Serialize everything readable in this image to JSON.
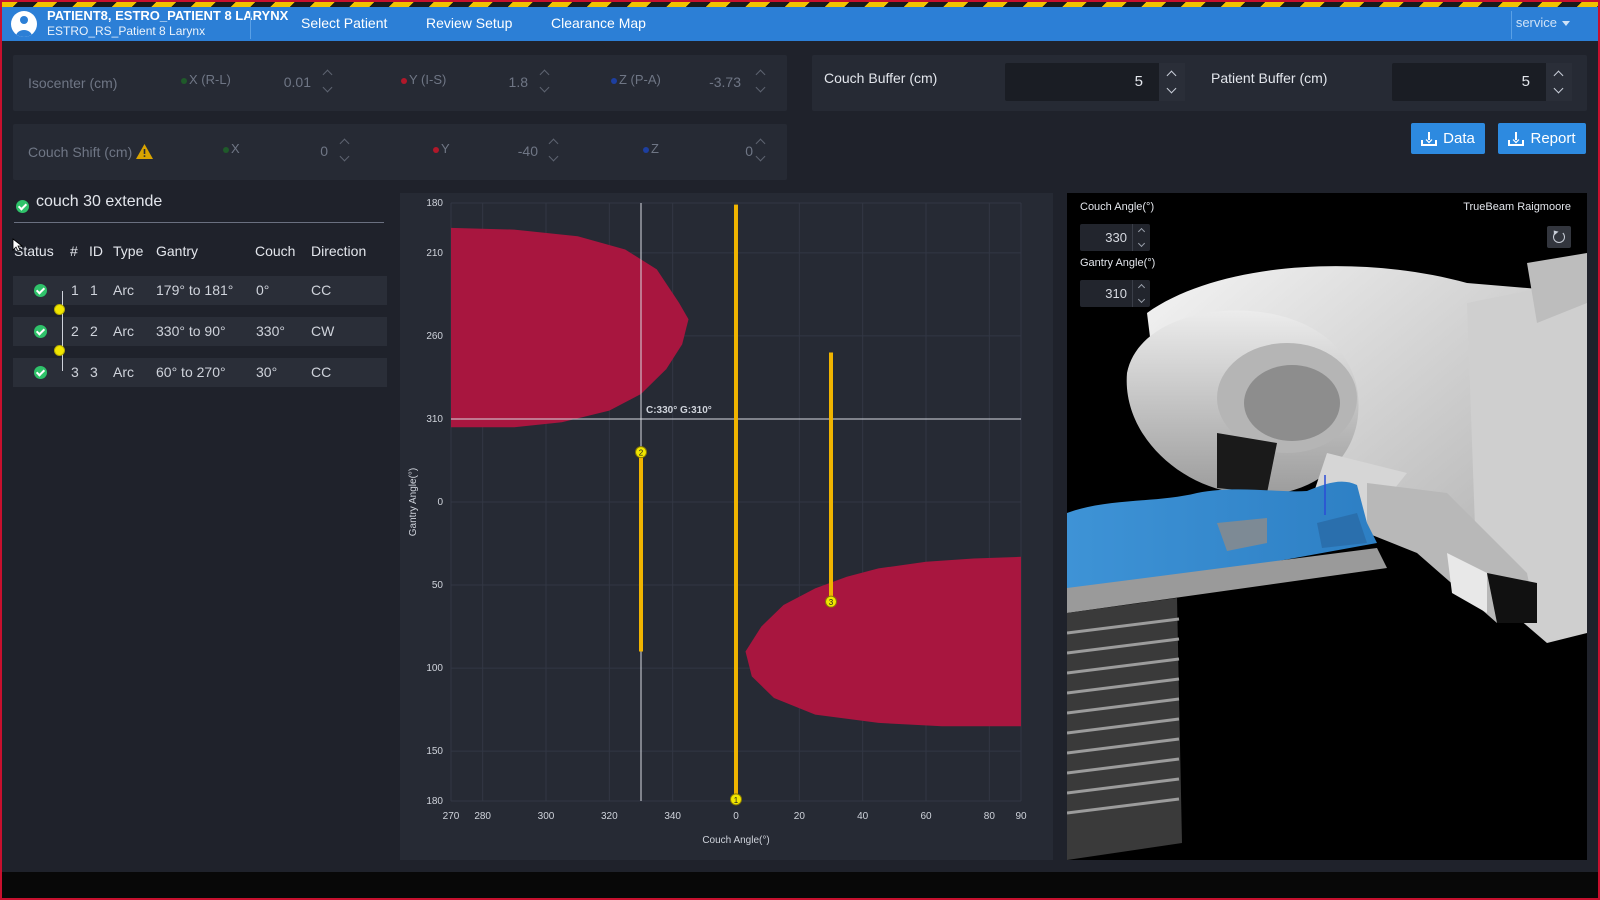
{
  "header": {
    "patient_name": "PATIENT8, ESTRO_PATIENT 8 LARYNX",
    "plan_name": "ESTRO_RS_Patient 8 Larynx",
    "nav": [
      {
        "label": "Select Patient"
      },
      {
        "label": "Review Setup"
      },
      {
        "label": "Clearance Map"
      }
    ],
    "active_nav": "Clearance Map",
    "user_menu": "service"
  },
  "isocenter": {
    "label": "Isocenter (cm)",
    "x": {
      "label": "X (R-L)",
      "value": "0.01"
    },
    "y": {
      "label": "Y (I-S)",
      "value": "1.8"
    },
    "z": {
      "label": "Z (P-A)",
      "value": "-3.73"
    }
  },
  "couch_shift": {
    "label": "Couch Shift (cm)",
    "x": {
      "label": "X",
      "value": "0"
    },
    "y": {
      "label": "Y",
      "value": "-40"
    },
    "z": {
      "label": "Z",
      "value": "0"
    }
  },
  "buffers": {
    "couch": {
      "label": "Couch Buffer (cm)",
      "value": "5"
    },
    "patient": {
      "label": "Patient Buffer (cm)",
      "value": "5"
    }
  },
  "buttons": {
    "data": "Data",
    "report": "Report"
  },
  "plan": {
    "title": "couch 30 extende",
    "columns": [
      "Status",
      "#",
      "ID",
      "Type",
      "Gantry",
      "Couch",
      "Direction"
    ],
    "rows": [
      {
        "num": "1",
        "id": "1",
        "type": "Arc",
        "gantry": "179° to 181°",
        "couch": "0°",
        "direction": "CC"
      },
      {
        "num": "2",
        "id": "2",
        "type": "Arc",
        "gantry": "330° to 90°",
        "couch": "330°",
        "direction": "CW"
      },
      {
        "num": "3",
        "id": "3",
        "type": "Arc",
        "gantry": "60° to 270°",
        "couch": "30°",
        "direction": "CC"
      }
    ]
  },
  "colors": {
    "collision": "#a8163f",
    "arc": "#f0b400",
    "accent": "#2d8ae0",
    "ok": "#2fc26a"
  },
  "chart_data": {
    "type": "scatter",
    "xlabel": "Couch Angle(°)",
    "ylabel": "Gantry Angle(°)",
    "x_ticks": [
      "270",
      "280",
      "300",
      "320",
      "340",
      "0",
      "20",
      "40",
      "60",
      "80",
      "90"
    ],
    "x_tick_values": [
      -90,
      -80,
      -60,
      -40,
      -20,
      0,
      20,
      40,
      60,
      80,
      90
    ],
    "y_ticks": [
      "180",
      "210",
      "260",
      "310",
      "0",
      "50",
      "100",
      "150",
      "180"
    ],
    "y_tick_values": [
      -180,
      -150,
      -100,
      -50,
      0,
      50,
      100,
      150,
      180
    ],
    "xlim": [
      -90,
      90
    ],
    "ylim": [
      -180,
      180
    ],
    "cursor": {
      "couch": -30,
      "gantry": -50,
      "label": "C:330° G:310°"
    },
    "collision_regions": [
      {
        "name": "upper-left",
        "outline": [
          [
            -90,
            -165
          ],
          [
            -70,
            -164
          ],
          [
            -50,
            -160
          ],
          [
            -35,
            -152
          ],
          [
            -25,
            -140
          ],
          [
            -18,
            -120
          ],
          [
            -15,
            -110
          ],
          [
            -17,
            -95
          ],
          [
            -22,
            -80
          ],
          [
            -30,
            -65
          ],
          [
            -40,
            -55
          ],
          [
            -55,
            -48
          ],
          [
            -70,
            -45
          ],
          [
            -90,
            -45
          ]
        ]
      },
      {
        "name": "lower-right",
        "outline": [
          [
            90,
            33
          ],
          [
            75,
            34
          ],
          [
            60,
            36
          ],
          [
            45,
            40
          ],
          [
            35,
            45
          ],
          [
            25,
            52
          ],
          [
            15,
            62
          ],
          [
            8,
            75
          ],
          [
            3,
            90
          ],
          [
            5,
            105
          ],
          [
            12,
            118
          ],
          [
            25,
            128
          ],
          [
            45,
            133
          ],
          [
            65,
            135
          ],
          [
            90,
            135
          ]
        ]
      }
    ],
    "arcs": [
      {
        "label": "1",
        "couch": 0,
        "gantry_start": -179,
        "gantry_end": 179,
        "marker_at": 179
      },
      {
        "label": "2",
        "couch": -30,
        "gantry_start": -30,
        "gantry_end": 90,
        "marker_at": -30
      },
      {
        "label": "3",
        "couch": 30,
        "gantry_start": -90,
        "gantry_end": 60,
        "marker_at": 60
      }
    ]
  },
  "viewport": {
    "couch_label": "Couch Angle(°)",
    "couch_value": "330",
    "gantry_label": "Gantry Angle(°)",
    "gantry_value": "310",
    "machine": "TrueBeam Raigmoore"
  }
}
